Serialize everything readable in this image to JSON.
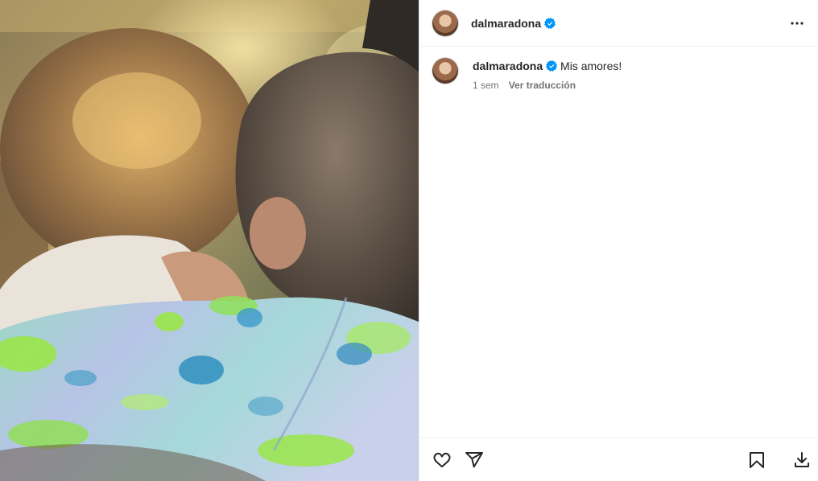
{
  "post": {
    "author": "dalmaradona",
    "verified": true,
    "caption": "Mis amores!",
    "time_ago": "1 sem",
    "translate_label": "Ver traducción"
  },
  "icons": {
    "more": "more-horizontal-icon",
    "like": "heart-icon",
    "share": "send-icon",
    "save": "bookmark-icon",
    "download": "download-icon",
    "verified": "verified-badge-icon"
  },
  "colors": {
    "verified_blue": "#0095f6",
    "text_primary": "#262626",
    "text_secondary": "#737373",
    "divider": "#efefef"
  }
}
